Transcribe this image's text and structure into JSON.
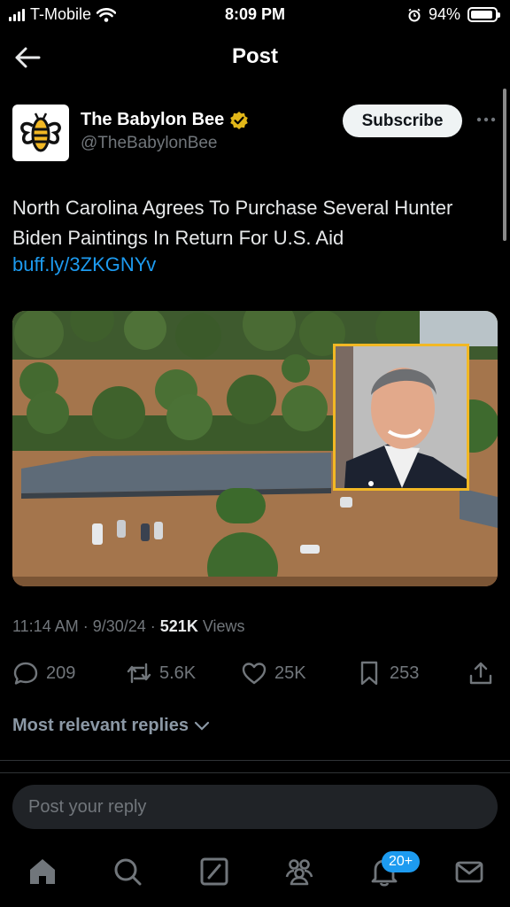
{
  "status_bar": {
    "carrier": "T-Mobile",
    "time": "8:09 PM",
    "battery": "94%",
    "battery_level": 0.94
  },
  "header": {
    "title": "Post"
  },
  "author": {
    "name": "The Babylon Bee",
    "handle": "@TheBabylonBee",
    "subscribe_label": "Subscribe",
    "verified_color": "#e2b719"
  },
  "post": {
    "text": "North Carolina Agrees To Purchase Several Hunter Biden Paintings In Return For U.S. Aid",
    "link": "buff.ly/3ZKGNYv"
  },
  "meta": {
    "time": "11:14 AM",
    "date": "9/30/24",
    "views_count": "521K",
    "views_label": "Views"
  },
  "actions": {
    "replies": "209",
    "reposts": "5.6K",
    "likes": "25K",
    "bookmarks": "253"
  },
  "replies_filter": "Most relevant replies",
  "reply_input": {
    "placeholder": "Post your reply"
  },
  "tabbar": {
    "notifications_badge": "20+"
  },
  "colors": {
    "accent": "#1d9bf0",
    "background": "#000000",
    "muted": "#71767b"
  }
}
